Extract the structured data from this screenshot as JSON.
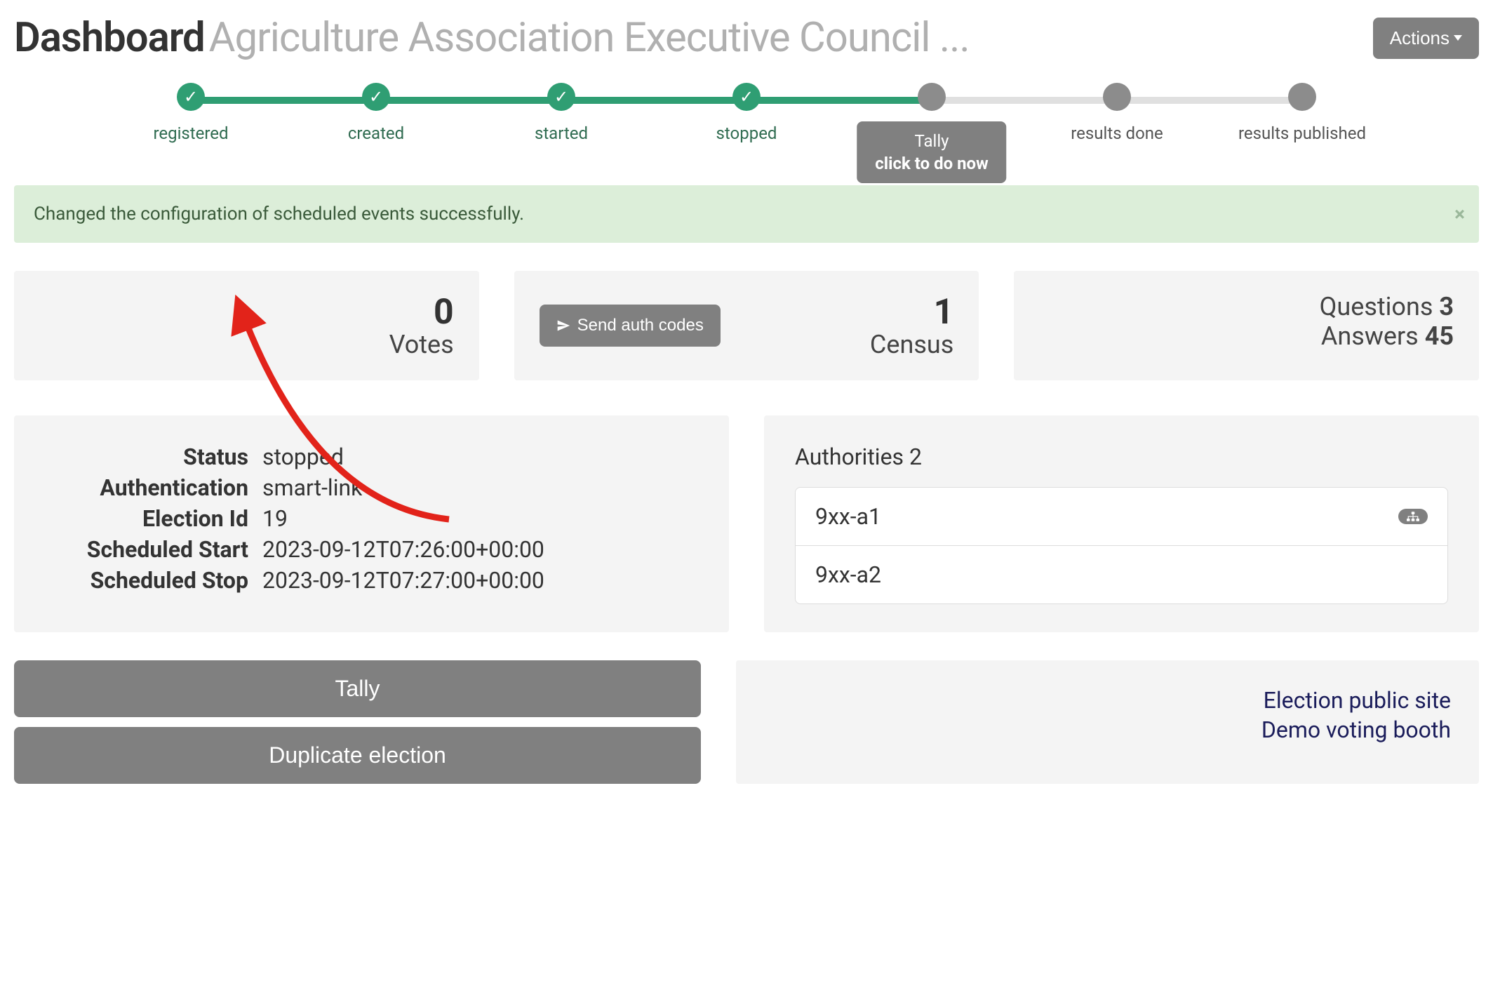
{
  "header": {
    "title_label": "Dashboard",
    "subtitle": "Agriculture Association Executive Council ...",
    "actions_label": "Actions"
  },
  "steps": [
    {
      "label": "registered",
      "state": "done"
    },
    {
      "label": "created",
      "state": "done"
    },
    {
      "label": "started",
      "state": "done"
    },
    {
      "label": "stopped",
      "state": "done"
    },
    {
      "label": "Tally",
      "state": "current",
      "callout_sub": "click to do now"
    },
    {
      "label": "results done",
      "state": "pending"
    },
    {
      "label": "results published",
      "state": "pending"
    }
  ],
  "alert": {
    "message": "Changed the configuration of scheduled events successfully."
  },
  "stats": {
    "votes_value": "0",
    "votes_label": "Votes",
    "census_value": "1",
    "census_label": "Census",
    "send_auth_label": "Send auth codes",
    "questions_label": "Questions",
    "questions_value": "3",
    "answers_label": "Answers",
    "answers_value": "45"
  },
  "details": {
    "status_label": "Status",
    "status_value": "stopped",
    "auth_label": "Authentication",
    "auth_value": "smart-link",
    "eid_label": "Election Id",
    "eid_value": "19",
    "sstart_label": "Scheduled Start",
    "sstart_value": "2023-09-12T07:26:00+00:00",
    "sstop_label": "Scheduled Stop",
    "sstop_value": "2023-09-12T07:27:00+00:00"
  },
  "authorities": {
    "header_label": "Authorities",
    "count": "2",
    "items": [
      {
        "name": "9xx-a1",
        "badge": true
      },
      {
        "name": "9xx-a2",
        "badge": false
      }
    ]
  },
  "bottom": {
    "tally_btn": "Tally",
    "dup_btn": "Duplicate election",
    "link_public": "Election public site",
    "link_demo": "Demo voting booth"
  }
}
